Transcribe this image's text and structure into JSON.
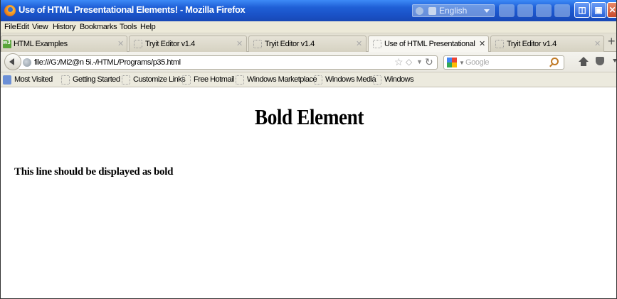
{
  "window": {
    "title": "Use of HTML Presentational Elements! - Mozilla Firefox",
    "language_label": "English"
  },
  "menu": [
    "File",
    "Edit",
    "View",
    "History",
    "Bookmarks",
    "Tools",
    "Help"
  ],
  "tabs": [
    {
      "label": "HTML Examples",
      "active": false
    },
    {
      "label": "Tryit Editor v1.4",
      "active": false
    },
    {
      "label": "Tryit Editor v1.4",
      "active": false
    },
    {
      "label": "Use of HTML Presentational El...",
      "active": true
    },
    {
      "label": "Tryit Editor v1.4",
      "active": false
    }
  ],
  "new_tab_label": "+",
  "nav": {
    "url": "file:///G:/Mi2@n 5i.-/HTML/Programs/p35.html",
    "search_placeholder": "Google"
  },
  "bookmarks": [
    "Most Visited",
    "Getting Started",
    "Customize Links",
    "Free Hotmail",
    "Windows Marketplace",
    "Windows Media",
    "Windows"
  ],
  "page": {
    "heading": "Bold Element",
    "paragraph": "This line should be displayed as bold"
  },
  "icons": {
    "app": "firefox-icon",
    "back": "back-arrow-icon",
    "site": "globe-icon",
    "bookmark_star": "star-icon",
    "reload": "reload-icon",
    "search_engine": "google-icon",
    "search": "magnifier-icon",
    "home": "home-icon"
  }
}
